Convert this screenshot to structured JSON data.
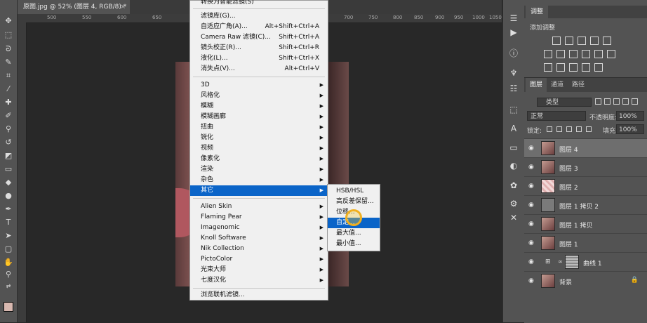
{
  "document": {
    "tab_title": "原图.jpg @ 52% (图层 4, RGB/8) *",
    "close": "×"
  },
  "ruler": {
    "ticks": [
      "500",
      "550",
      "600",
      "650",
      "700",
      "750",
      "800",
      "850",
      "900",
      "950",
      "1000",
      "1050"
    ]
  },
  "filter_menu": {
    "top_items": [
      {
        "label": "转换为智能滤镜(S)",
        "shortcut": ""
      },
      {
        "label": "滤镜库(G)...",
        "shortcut": ""
      },
      {
        "label": "自适应广角(A)...",
        "shortcut": "Alt+Shift+Ctrl+A"
      },
      {
        "label": "Camera Raw 滤镜(C)...",
        "shortcut": "Shift+Ctrl+A"
      },
      {
        "label": "镜头校正(R)...",
        "shortcut": "Shift+Ctrl+R"
      },
      {
        "label": "液化(L)...",
        "shortcut": "Shift+Ctrl+X"
      },
      {
        "label": "消失点(V)...",
        "shortcut": "Alt+Ctrl+V"
      }
    ],
    "group_items": [
      "3D",
      "风格化",
      "模糊",
      "模糊画廊",
      "扭曲",
      "锐化",
      "视频",
      "像素化",
      "渲染",
      "杂色",
      "其它"
    ],
    "plugin_items": [
      "Alien Skin",
      "Flaming Pear",
      "Imagenomic",
      "Knoll Software",
      "Nik Collection",
      "PictoColor",
      "光束大师",
      "七度汉化"
    ],
    "browse": "浏览联机滤镜...",
    "submenu_arrow": "▶"
  },
  "submenu": {
    "items": [
      "HSB/HSL",
      "高反差保留...",
      "位移...",
      "自定...",
      "最大值...",
      "最小值..."
    ],
    "selected_index": 3
  },
  "adjustments": {
    "tab": "调整",
    "title": "添加调整"
  },
  "layers": {
    "tabs": [
      "图层",
      "通道",
      "路径"
    ],
    "kind_filter": "类型",
    "blend_mode": "正常",
    "opacity_label": "不透明度:",
    "opacity": "100%",
    "lock_label": "锁定:",
    "fill_label": "填充:",
    "fill": "100%",
    "rows": [
      {
        "name": "图层 4",
        "selected": true
      },
      {
        "name": "图层 3",
        "selected": false
      },
      {
        "name": "图层 2",
        "selected": false
      },
      {
        "name": "图层 1 拷贝 2",
        "selected": false
      },
      {
        "name": "图层 1 拷贝",
        "selected": false
      },
      {
        "name": "图层 1",
        "selected": false
      },
      {
        "name": "曲线 1",
        "selected": false
      },
      {
        "name": "背景",
        "selected": false
      }
    ]
  },
  "colors": {
    "selection": "#0a64c8",
    "panel": "#535353",
    "canvas": "#282828",
    "menu_bg": "#f0f0f0"
  }
}
